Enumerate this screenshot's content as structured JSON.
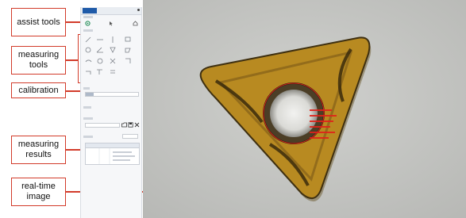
{
  "callouts": {
    "assist_tools": "assist tools",
    "measuring_tools": "measuring tools",
    "calibration": "calibration",
    "measuring_results": "measuring results",
    "realtime_image": "real-time image"
  },
  "colors": {
    "callout_border": "#d23b2a",
    "insert_gold": "#b88a21",
    "background_gray": "#c7c8c5",
    "annotation_red": "#e0221a"
  },
  "icons": [
    "target-icon",
    "pointer-icon",
    "home-icon",
    "line-icon",
    "circle-icon",
    "angle-icon",
    "rectangle-icon",
    "polygon-icon",
    "arc-icon",
    "folder-icon",
    "save-icon",
    "close-icon"
  ]
}
